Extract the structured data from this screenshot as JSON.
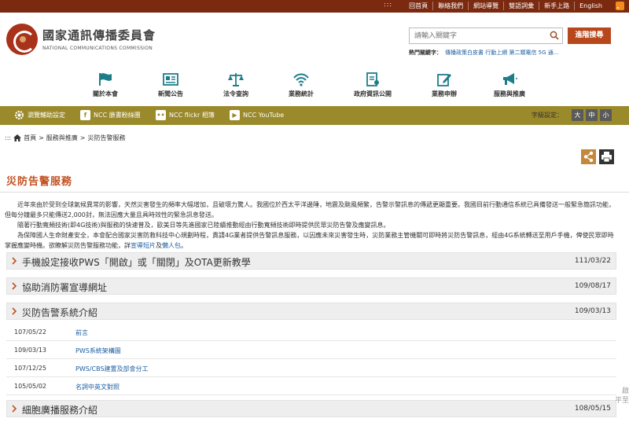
{
  "topbar": {
    "links": [
      "回首頁",
      "聯絡我們",
      "網站導覽",
      "雙語詞彙",
      "新手上路",
      "English"
    ],
    "dots": ":::"
  },
  "org": {
    "name": "國家通訊傳播委員會",
    "name_en": "NATIONAL COMMUNICATIONS COMMISSION"
  },
  "search": {
    "placeholder": "請輸入關鍵字",
    "advanced_label": "進階搜尋",
    "hot_label": "熱門關鍵字：",
    "hot_text": "傳播政策白皮書  行動上網  第二類電信  5G  通..."
  },
  "nav": [
    {
      "label": "關於本會",
      "icon": "flag-icon"
    },
    {
      "label": "新聞公告",
      "icon": "newspaper-icon"
    },
    {
      "label": "法令查詢",
      "icon": "scales-icon"
    },
    {
      "label": "業務統計",
      "icon": "wifi-icon"
    },
    {
      "label": "政府資訊公開",
      "icon": "document-icon"
    },
    {
      "label": "業務申辦",
      "icon": "edit-icon"
    },
    {
      "label": "服務與推廣",
      "icon": "megaphone-icon"
    }
  ],
  "quickbar": {
    "browse_settings": "瀏覽輔助設定",
    "facebook": "NCC 臉書粉絲團",
    "flickr": "NCC flickr 相簿",
    "youtube": "NCC YouTube",
    "font_label": "字級設定：",
    "font_sizes": [
      "大",
      "中",
      "小"
    ]
  },
  "breadcrumb": {
    "dots": ":::",
    "items": [
      "首頁",
      "服務與推廣",
      "災防告警服務"
    ],
    "sep": ">"
  },
  "page": {
    "title": "災防告警服務",
    "p1": "　　近年來由於受到全球氣候異常的影響，天然災害發生的頻率大幅增加，且破壞力驚人。我國位於西太平洋邊陲，地震及颱風頻繁，告警示警訊息的傳遞更顯重要。我國目前行動通信系統已具備發送一般緊急簡訊功能，但每分鐘最多只能傳送2,000封，無法因應大量且具時效性的緊急訊息發送。",
    "p2": "　　隨著行動寬頻技術(即4G技術)與服務的快速普及，歐美日等先進國家已陸續推動經由行動寬頻技術即時提供民眾災防告警及應變訊息。",
    "p3_pre": "　　為保障國人生命財產安全，本會配合國家災害防救科技中心規劃時程，責請4G業者提供告警訊息服務，以因應未來災害發生時，災防業務主管機關可即時將災防告警訊息，經由4G系統轉送至用戶手機，俾使民眾即時掌握應變時機。欲瞭解災防告警服務功能，詳",
    "p3_link1": "宣導短片",
    "p3_mid": "及",
    "p3_link2": "懶人包",
    "p3_end": "。"
  },
  "accordions": [
    {
      "title": "手機設定接收PWS「開啟」或「關閉」及OTA更新教學",
      "date": "111/03/22"
    },
    {
      "title": "協助消防署宣導網址",
      "date": "109/08/17"
    },
    {
      "title": "災防告警系統介紹",
      "date": "109/03/13"
    },
    {
      "title": "細胞廣播服務介紹",
      "date": "108/05/15"
    }
  ],
  "sub_items": [
    {
      "date": "107/05/22",
      "title": "前言"
    },
    {
      "date": "109/03/13",
      "title": "PWS系統架構圖"
    },
    {
      "date": "107/12/25",
      "title": "PWS/CBS建置及部會分工"
    },
    {
      "date": "105/05/02",
      "title": "名詞中英文對照"
    }
  ],
  "corner": [
    "啟",
    "平至"
  ],
  "colors": {
    "topbar": "#7b2a10",
    "accent": "#c2501f",
    "olive": "#9a8a2b",
    "link": "#1c5ea0"
  }
}
